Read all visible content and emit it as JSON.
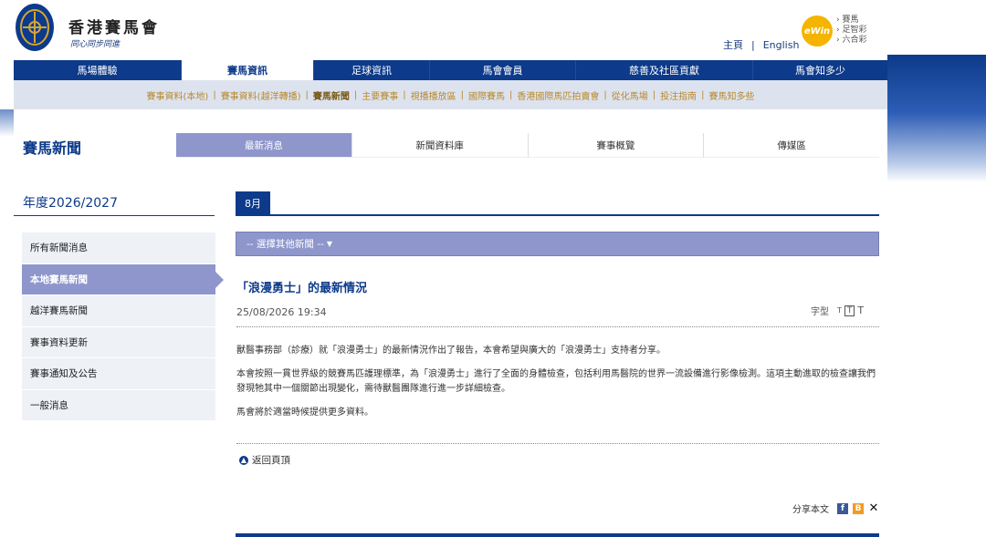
{
  "header": {
    "brand": "香港賽馬會",
    "slogan": "同心同步同進",
    "top_links": [
      "主頁",
      "English"
    ],
    "ewin_label": "eWin",
    "ewin_items": [
      "賽馬",
      "足智彩",
      "六合彩"
    ]
  },
  "main_nav": [
    "馬場體驗",
    "賽馬資訊",
    "足球資訊",
    "馬會會員",
    "慈善及社區貢獻",
    "馬會知多少"
  ],
  "sub_nav": [
    "賽事資料(本地)",
    "賽事資料(越洋轉播)",
    "賽馬新聞",
    "主要賽事",
    "視播播放區",
    "國際賽馬",
    "香港國際馬匹拍賣會",
    "從化馬場",
    "投注指南",
    "賽馬知多些"
  ],
  "page": {
    "title": "賽馬新聞",
    "tabs": [
      "最新消息",
      "新聞資料庫",
      "賽事概覽",
      "傳媒區"
    ]
  },
  "year_label": "年度2026/2027",
  "month_tab": "8月",
  "side_menu": [
    "所有新聞消息",
    "本地賽馬新聞",
    "越洋賽馬新聞",
    "賽事資料更新",
    "賽事通知及公告",
    "一般消息"
  ],
  "selector_label": "-- 選擇其他新聞 --",
  "article": {
    "title": "「浪漫勇士」的最新情況",
    "datetime": "25/08/2026 19:34",
    "font_label": "字型",
    "paragraphs": [
      "獸醫事務部（診療）就「浪漫勇士」的最新情況作出了報告，本會希望與廣大的「浪漫勇士」支持者分享。",
      "本會按照一貫世界級的競賽馬匹護理標準，為「浪漫勇士」進行了全面的身體檢查，包括利用馬醫院的世界一流設備進行影像檢測。這項主動進取的檢查讓我們發現牠其中一個關節出現變化，需待獸醫團隊進行進一步詳細檢查。",
      "馬會將於適當時候提供更多資料。"
    ],
    "back_label": "返回頁頂",
    "share_label": "分享本文"
  },
  "colors": {
    "navy": "#0d3a8a",
    "lavender": "#8e96cc",
    "gold": "#b8892e"
  }
}
